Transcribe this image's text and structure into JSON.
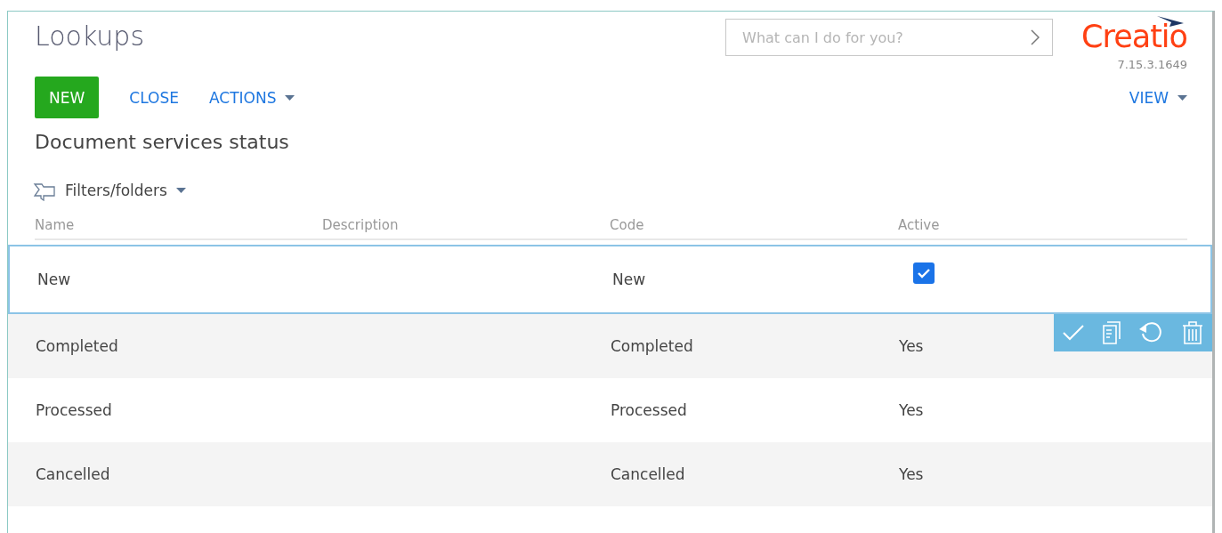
{
  "header": {
    "title": "Lookups",
    "search": {
      "placeholder": "What can I do for you?"
    },
    "logo": "Creatio",
    "version": "7.15.3.1649"
  },
  "toolbar": {
    "new": "NEW",
    "close": "CLOSE",
    "actions": "ACTIONS",
    "view": "VIEW"
  },
  "section_title": "Document services status",
  "filters": "Filters/folders",
  "table": {
    "columns": [
      "Name",
      "Description",
      "Code",
      "Active"
    ],
    "rows": [
      {
        "name": "New",
        "code": "New",
        "selected": true,
        "checked": true
      },
      {
        "name": "Completed",
        "code": "Completed",
        "selected": false,
        "active": "Yes"
      },
      {
        "name": "Processed",
        "code": "Processed",
        "selected": false,
        "active": "Yes"
      },
      {
        "name": "Cancelled",
        "code": "Cancelled",
        "selected": false,
        "active": "Yes"
      }
    ]
  }
}
